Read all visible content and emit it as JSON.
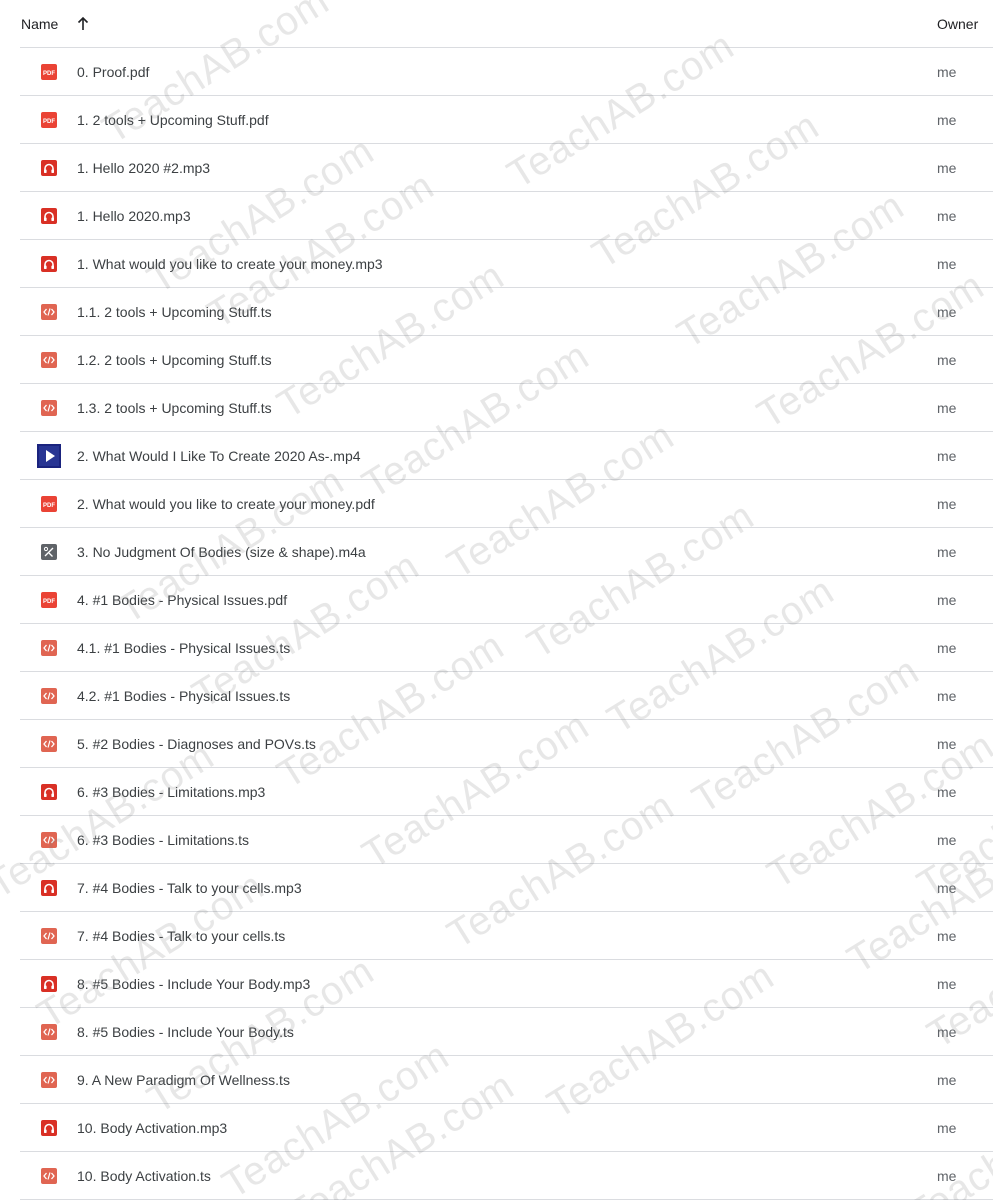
{
  "header": {
    "name_label": "Name",
    "sort_icon": "arrow-up-icon",
    "owner_label": "Owner"
  },
  "colors": {
    "pdf": "#ea4335",
    "audio": "#d93025",
    "code": "#e06552",
    "divider": "#dadce0"
  },
  "files": [
    {
      "name": "0. Proof.pdf",
      "type": "pdf",
      "owner": "me"
    },
    {
      "name": "1. 2 tools + Upcoming Stuff.pdf",
      "type": "pdf",
      "owner": "me"
    },
    {
      "name": "1. Hello 2020 #2.mp3",
      "type": "audio",
      "owner": "me"
    },
    {
      "name": "1. Hello 2020.mp3",
      "type": "audio",
      "owner": "me"
    },
    {
      "name": "1. What would you like to create your money.mp3",
      "type": "audio",
      "owner": "me"
    },
    {
      "name": "1.1. 2 tools + Upcoming Stuff.ts",
      "type": "code",
      "owner": "me"
    },
    {
      "name": "1.2. 2 tools + Upcoming Stuff.ts",
      "type": "code",
      "owner": "me"
    },
    {
      "name": "1.3. 2 tools + Upcoming Stuff.ts",
      "type": "code",
      "owner": "me"
    },
    {
      "name": "2. What Would I Like To Create 2020 As-.mp4",
      "type": "video",
      "owner": "me"
    },
    {
      "name": "2. What would you like to create your money.pdf",
      "type": "pdf",
      "owner": "me"
    },
    {
      "name": "3. No Judgment Of Bodies (size & shape).m4a",
      "type": "m4a",
      "owner": "me"
    },
    {
      "name": "4. #1 Bodies - Physical Issues.pdf",
      "type": "pdf",
      "owner": "me"
    },
    {
      "name": "4.1. #1 Bodies - Physical Issues.ts",
      "type": "code",
      "owner": "me"
    },
    {
      "name": "4.2. #1 Bodies - Physical Issues.ts",
      "type": "code",
      "owner": "me"
    },
    {
      "name": "5. #2 Bodies - Diagnoses and POVs.ts",
      "type": "code",
      "owner": "me"
    },
    {
      "name": "6. #3 Bodies - Limitations.mp3",
      "type": "audio",
      "owner": "me"
    },
    {
      "name": "6. #3 Bodies - Limitations.ts",
      "type": "code",
      "owner": "me"
    },
    {
      "name": "7. #4 Bodies - Talk to your cells.mp3",
      "type": "audio",
      "owner": "me"
    },
    {
      "name": "7. #4 Bodies - Talk to your cells.ts",
      "type": "code",
      "owner": "me"
    },
    {
      "name": "8. #5 Bodies - Include Your Body.mp3",
      "type": "audio",
      "owner": "me"
    },
    {
      "name": "8. #5 Bodies - Include Your Body.ts",
      "type": "code",
      "owner": "me"
    },
    {
      "name": "9. A New Paradigm Of Wellness.ts",
      "type": "code",
      "owner": "me"
    },
    {
      "name": "10. Body Activation.mp3",
      "type": "audio",
      "owner": "me"
    },
    {
      "name": "10. Body Activation.ts",
      "type": "code",
      "owner": "me"
    }
  ],
  "watermark": "TeachAB.com"
}
